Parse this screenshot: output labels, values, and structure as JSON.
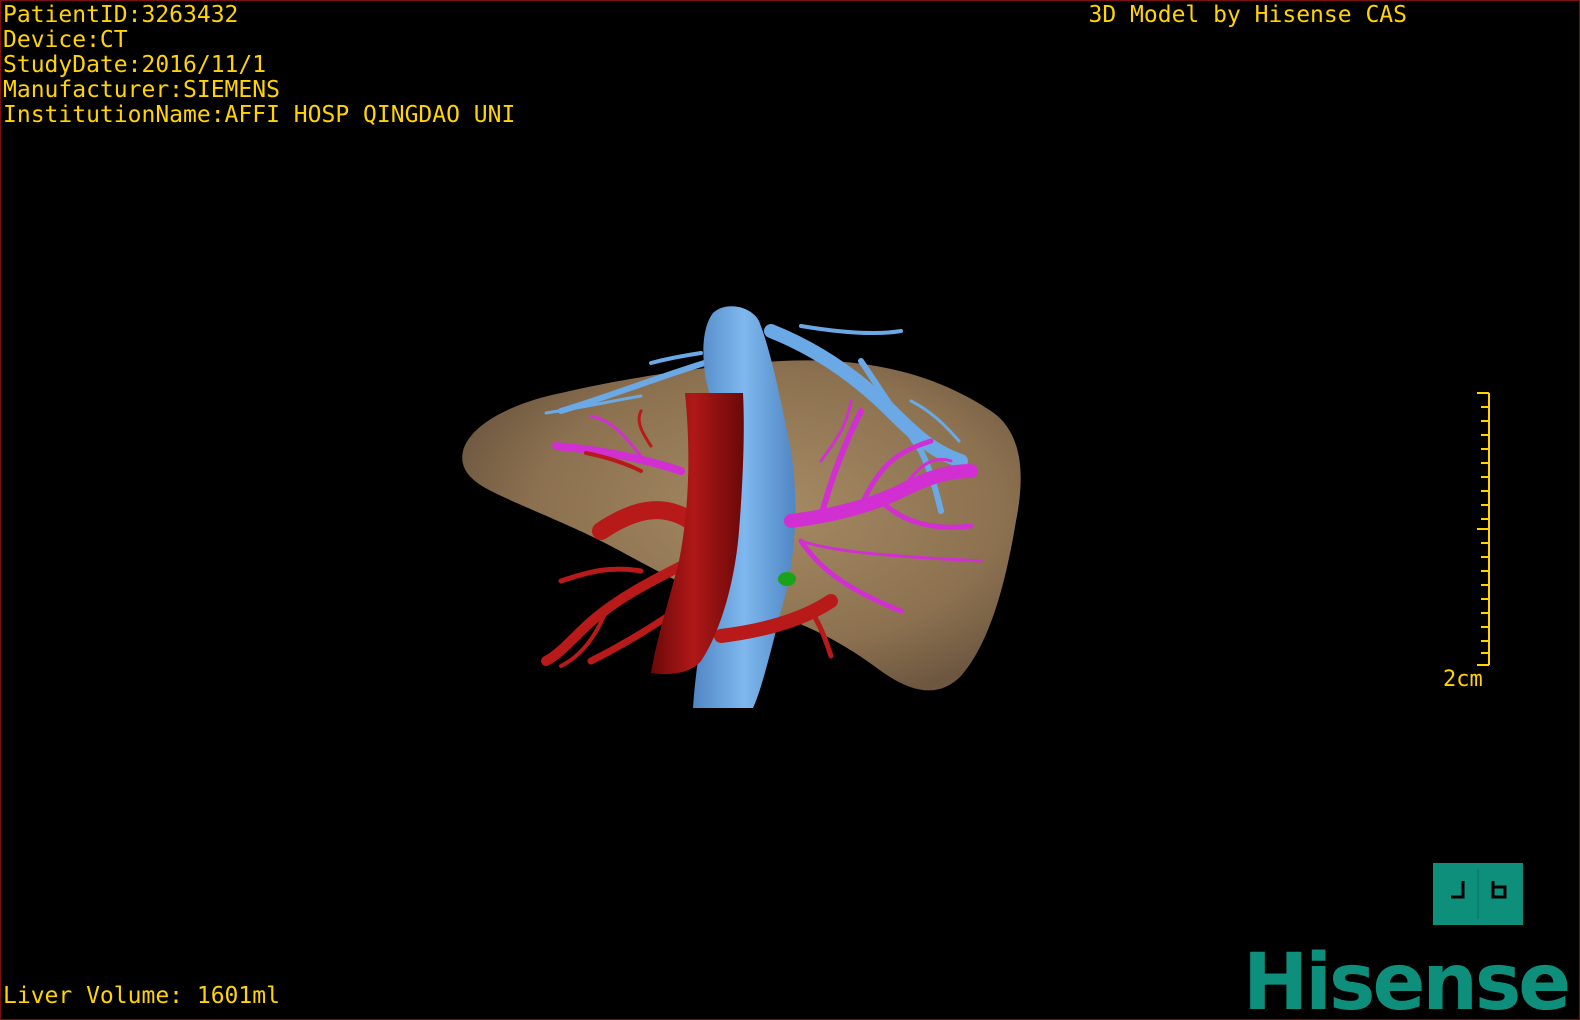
{
  "patient": {
    "id_line": "PatientID:3263432",
    "device_line": "Device:CT",
    "study_date_line": "StudyDate:2016/11/1",
    "manufacturer_line": "Manufacturer:SIEMENS",
    "institution_line": "InstitutionName:AFFI HOSP QINGDAO UNI"
  },
  "credit": "3D Model by Hisense CAS",
  "liver_volume": "Liver Volume: 1601ml",
  "scale": {
    "label": "2cm"
  },
  "brand": {
    "logo_text": "Hisense"
  },
  "model_parts": [
    {
      "name": "liver",
      "color": "#9a7f5a"
    },
    {
      "name": "hepatic-vein",
      "color": "#6aa9e6"
    },
    {
      "name": "inferior-vena-cava",
      "color": "#6aa9e6"
    },
    {
      "name": "portal-vein",
      "color": "#d22fd2"
    },
    {
      "name": "hepatic-artery",
      "color": "#b81a1a"
    },
    {
      "name": "aorta",
      "color": "#8f0d0d"
    },
    {
      "name": "lesion",
      "color": "#1aa31a"
    }
  ],
  "colors": {
    "overlay_text": "#ffd400",
    "brand": "#0e8f7c",
    "frame": "#7a1010"
  },
  "icons": {
    "view_toggle": "flip-view-icon"
  }
}
